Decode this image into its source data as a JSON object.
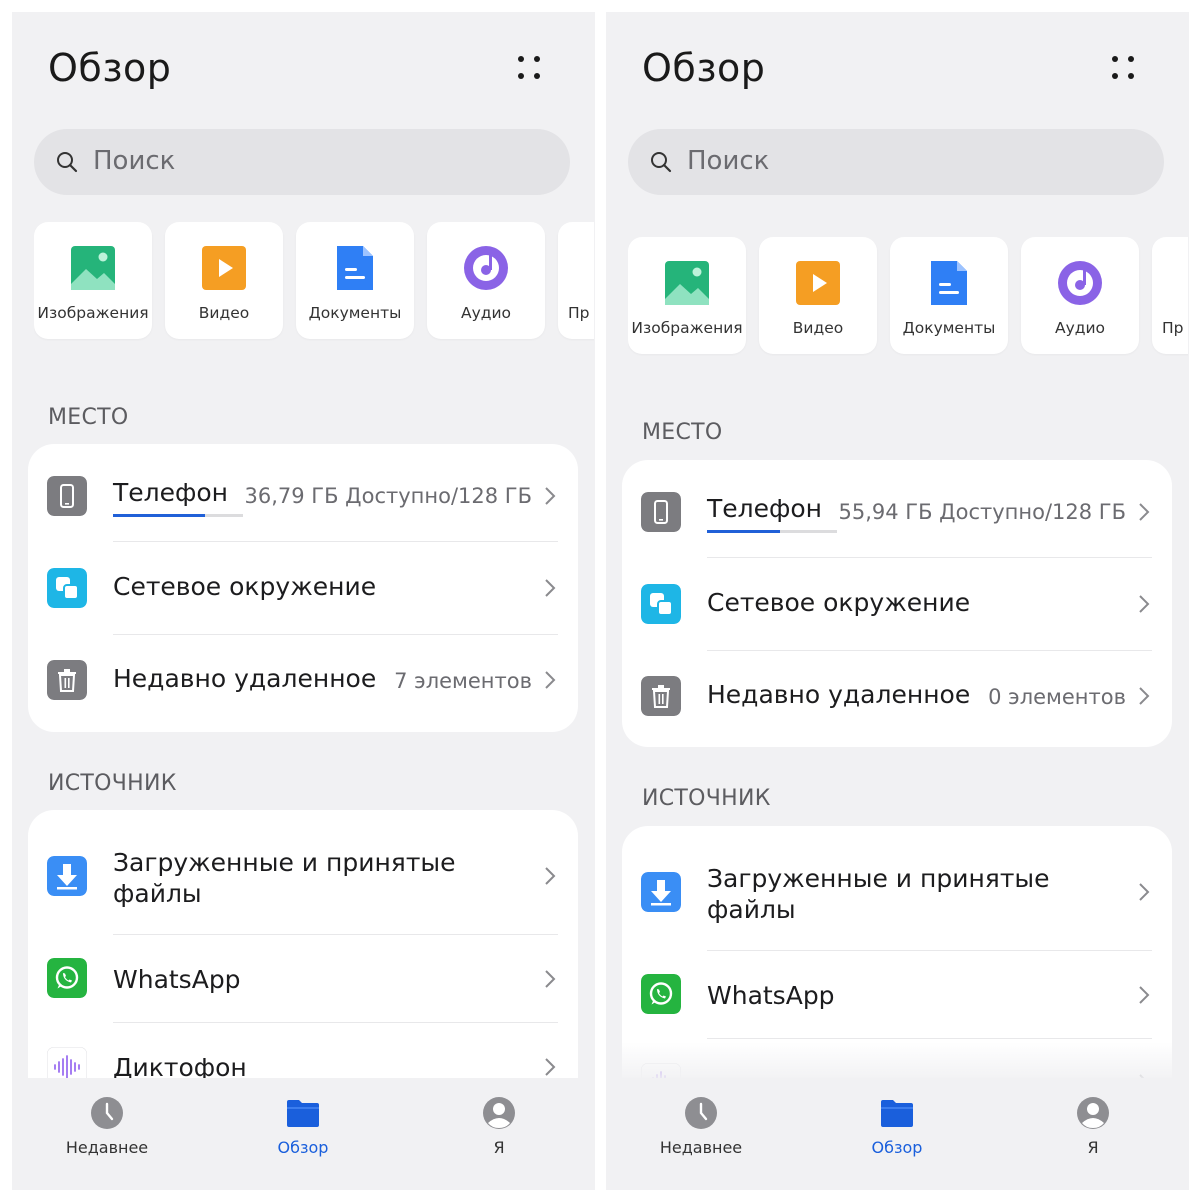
{
  "screens": [
    {
      "title": "Обзор",
      "search_placeholder": "Поиск",
      "categories": [
        {
          "label": "Изображения",
          "icon": "image-icon"
        },
        {
          "label": "Видео",
          "icon": "video-icon"
        },
        {
          "label": "Документы",
          "icon": "document-icon"
        },
        {
          "label": "Аудио",
          "icon": "audio-icon"
        },
        {
          "label": "Пр",
          "icon": ""
        }
      ],
      "location_label": "МЕСТО",
      "phone": {
        "label": "Телефон",
        "value": "36,79 ГБ Доступно/128 ГБ",
        "used_fraction": 0.71
      },
      "network": {
        "label": "Сетевое окружение"
      },
      "deleted": {
        "label": "Недавно удаленное",
        "value": "7 элементов"
      },
      "source_label": "ИСТОЧНИК",
      "downloads": {
        "label": "Загруженные и принятые файлы",
        "line1": "Загруженные и принятые",
        "line2": "файлы"
      },
      "whatsapp": {
        "label": "WhatsApp"
      },
      "dictaphone": {
        "label": "Диктофон"
      },
      "nav": {
        "recent": "Недавнее",
        "browse": "Обзор",
        "me": "Я"
      }
    },
    {
      "title": "Обзор",
      "search_placeholder": "Поиск",
      "categories": [
        {
          "label": "Изображения",
          "icon": "image-icon"
        },
        {
          "label": "Видео",
          "icon": "video-icon"
        },
        {
          "label": "Документы",
          "icon": "document-icon"
        },
        {
          "label": "Аудио",
          "icon": "audio-icon"
        },
        {
          "label": "Пр",
          "icon": ""
        }
      ],
      "location_label": "МЕСТО",
      "phone": {
        "label": "Телефон",
        "value": "55,94 ГБ Доступно/128 ГБ",
        "used_fraction": 0.56
      },
      "network": {
        "label": "Сетевое окружение"
      },
      "deleted": {
        "label": "Недавно удаленное",
        "value": "0 элементов"
      },
      "source_label": "ИСТОЧНИК",
      "downloads": {
        "label": "Загруженные и принятые файлы",
        "line1": "Загруженные и принятые",
        "line2": "файлы"
      },
      "whatsapp": {
        "label": "WhatsApp"
      },
      "nav": {
        "recent": "Недавнее",
        "browse": "Обзор",
        "me": "Я"
      }
    }
  ],
  "colors": {
    "accent": "#1a5fdc",
    "whatsapp": "#25b440",
    "network": "#1eb6e6",
    "downloads": "#3a8ef5",
    "gray_icon": "#7c7c80"
  }
}
